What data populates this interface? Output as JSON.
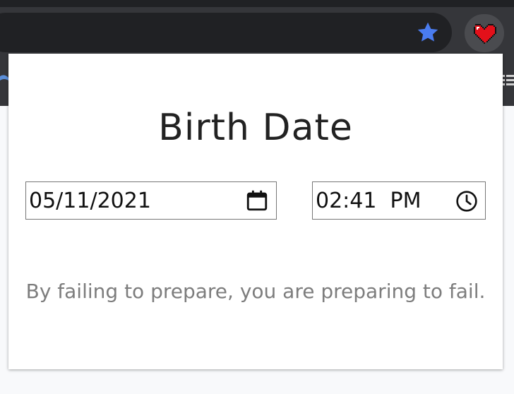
{
  "browser": {
    "icons": {
      "bookmark": "star-icon",
      "extension": "pixel-heart-icon"
    },
    "colors": {
      "star": "#4a7cf0",
      "heart": "#e3101a"
    }
  },
  "popup": {
    "title": "Birth Date",
    "date_field": {
      "value": "05/11/2021",
      "icon": "calendar-icon"
    },
    "time_field": {
      "value": "02:41  PM",
      "icon": "clock-icon"
    },
    "quote": "By failing to prepare, you are preparing to fail."
  }
}
